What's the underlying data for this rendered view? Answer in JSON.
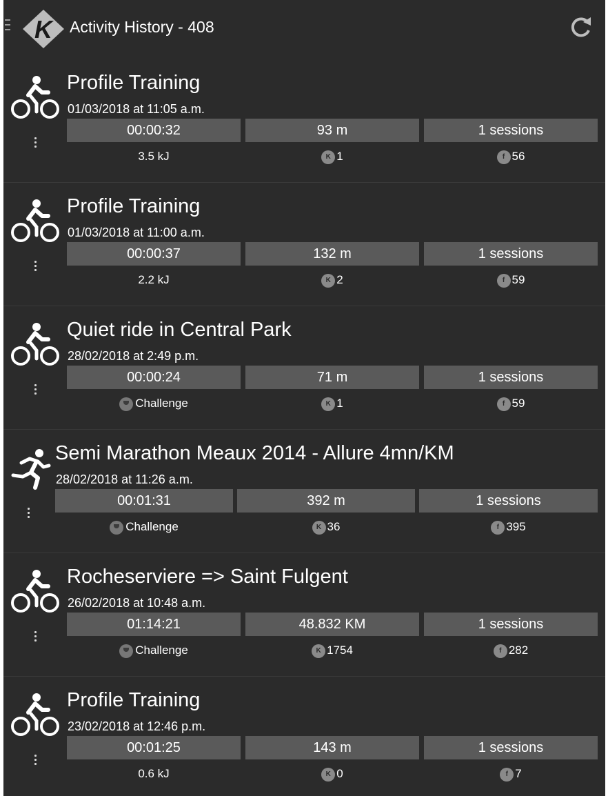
{
  "header": {
    "title": "Activity History - 408"
  },
  "activities": [
    {
      "type": "bike",
      "title": "Profile Training",
      "date": "01/03/2018 at 11:05 a.m.",
      "duration": "00:00:32",
      "distance": "93 m",
      "sessions": "1 sessions",
      "left_kind": "energy",
      "left_text": "3.5 kJ",
      "k_value": "1",
      "f_value": "56"
    },
    {
      "type": "bike",
      "title": "Profile Training",
      "date": "01/03/2018 at 11:00 a.m.",
      "duration": "00:00:37",
      "distance": "132 m",
      "sessions": "1 sessions",
      "left_kind": "energy",
      "left_text": "2.2 kJ",
      "k_value": "2",
      "f_value": "59"
    },
    {
      "type": "bike",
      "title": "Quiet ride in Central Park",
      "date": "28/02/2018 at 2:49 p.m.",
      "duration": "00:00:24",
      "distance": "71 m",
      "sessions": "1 sessions",
      "left_kind": "challenge",
      "left_text": "Challenge",
      "k_value": "1",
      "f_value": "59"
    },
    {
      "type": "run",
      "title": "Semi Marathon Meaux 2014 - Allure 4mn/KM",
      "date": "28/02/2018 at 11:26 a.m.",
      "duration": "00:01:31",
      "distance": "392 m",
      "sessions": "1 sessions",
      "left_kind": "challenge",
      "left_text": "Challenge",
      "k_value": "36",
      "f_value": "395"
    },
    {
      "type": "bike",
      "title": "Rocheserviere => Saint Fulgent",
      "date": "26/02/2018 at 10:48 a.m.",
      "duration": "01:14:21",
      "distance": "48.832 KM",
      "sessions": "1 sessions",
      "left_kind": "challenge",
      "left_text": "Challenge",
      "k_value": "1754",
      "f_value": "282"
    },
    {
      "type": "bike",
      "title": "Profile Training",
      "date": "23/02/2018 at 12:46 p.m.",
      "duration": "00:01:25",
      "distance": "143 m",
      "sessions": "1 sessions",
      "left_kind": "energy",
      "left_text": "0.6 kJ",
      "k_value": "0",
      "f_value": "7"
    }
  ],
  "colors": {
    "background": "#2b2b2b",
    "stat_box": "#5a5a5a",
    "text": "#ffffff",
    "badge": "#8a8a8a"
  }
}
